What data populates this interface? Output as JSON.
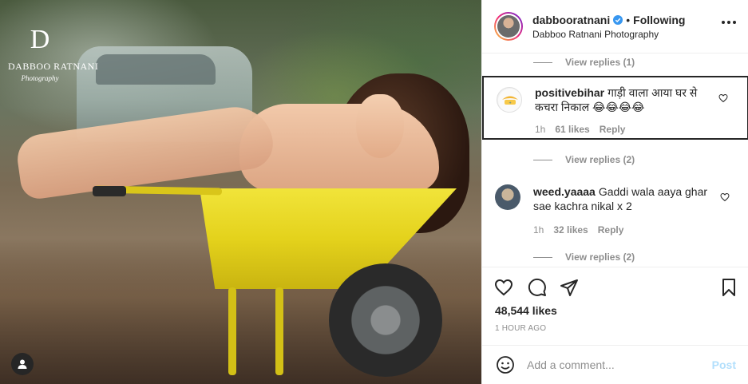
{
  "photo": {
    "watermark_mark": "D",
    "watermark_name": "DABBOO RATNANI",
    "watermark_sub": "Photography"
  },
  "header": {
    "username": "dabbooratnani",
    "separator": "•",
    "follow_status": "Following",
    "subtitle": "Dabboo Ratnani Photography"
  },
  "comments": {
    "view_replies_top": "View replies (1)",
    "items": [
      {
        "username": "positivebihar",
        "text": "गाड़ी वाला आया घर से कचरा निकाल 😂😂😂😂",
        "time": "1h",
        "likes": "61 likes",
        "reply": "Reply",
        "view_replies": "View replies (2)"
      },
      {
        "username": "weed.yaaaa",
        "text": "Gaddi wala aaya ghar sae kachra nikal x 2",
        "time": "1h",
        "likes": "32 likes",
        "reply": "Reply",
        "view_replies": "View replies (2)"
      }
    ]
  },
  "actions": {
    "likes": "48,544 likes",
    "time_ago": "1 HOUR AGO"
  },
  "add_comment": {
    "placeholder": "Add a comment...",
    "post_label": "Post"
  },
  "colors": {
    "link_disabled": "#b2dffc",
    "secondary_text": "#8e8e8e",
    "primary_text": "#262626",
    "verified_blue": "#3897f0"
  }
}
